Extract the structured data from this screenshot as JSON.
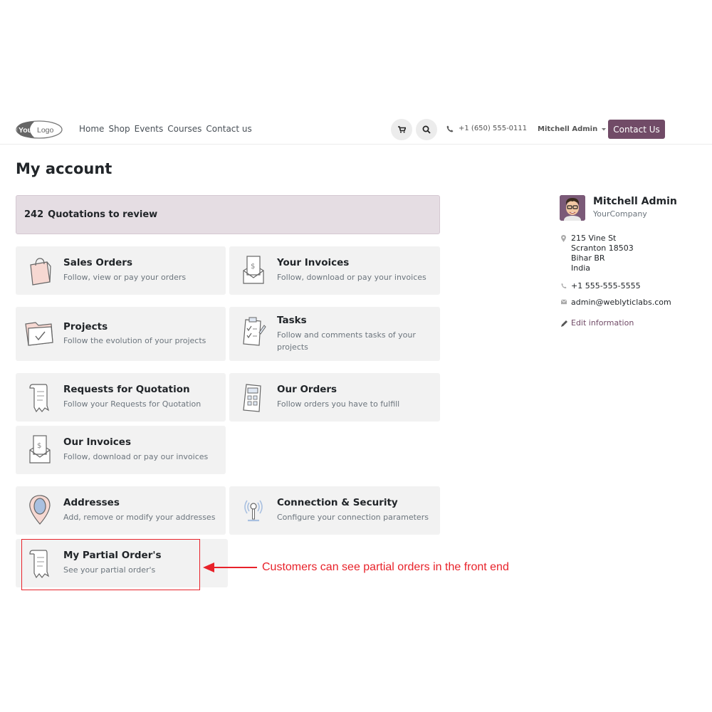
{
  "header": {
    "logo_text": "YourLogo",
    "nav": [
      "Home",
      "Shop",
      "Events",
      "Courses",
      "Contact us"
    ],
    "phone": "+1 (650) 555-0111",
    "user": "Mitchell Admin",
    "contact_button": "Contact Us",
    "brand_color": "#714b67"
  },
  "page": {
    "title": "My account"
  },
  "alert": {
    "count": "242",
    "label": "Quotations to review"
  },
  "cards": [
    {
      "title": "Sales Orders",
      "desc": "Follow, view or pay your orders",
      "icon": "shopping-bag-icon"
    },
    {
      "title": "Your Invoices",
      "desc": "Follow, download or pay your invoices",
      "icon": "invoice-envelope-icon"
    },
    {
      "title": "Projects",
      "desc": "Follow the evolution of your projects",
      "icon": "folder-check-icon"
    },
    {
      "title": "Tasks",
      "desc": "Follow and comments tasks of your projects",
      "icon": "checklist-icon"
    },
    {
      "title": "Requests for Quotation",
      "desc": "Follow your Requests for Quotation",
      "icon": "receipt-scroll-icon"
    },
    {
      "title": "Our Orders",
      "desc": "Follow orders you have to fulfill",
      "icon": "calculator-icon"
    },
    {
      "title": "Our Invoices",
      "desc": "Follow, download or pay our invoices",
      "icon": "invoice-envelope-icon"
    },
    {
      "title": "Addresses",
      "desc": "Add, remove or modify your addresses",
      "icon": "map-pin-icon"
    },
    {
      "title": "Connection & Security",
      "desc": "Configure your connection parameters",
      "icon": "signal-antenna-icon"
    },
    {
      "title": "My Partial Order's",
      "desc": "See your partial order's",
      "icon": "receipt-scroll-icon"
    }
  ],
  "sidebar": {
    "name": "Mitchell Admin",
    "company": "YourCompany",
    "address": [
      "215 Vine St",
      "Scranton 18503",
      "Bihar BR",
      "India"
    ],
    "phone": "+1 555-555-5555",
    "email": "admin@weblyticlabs.com",
    "edit_label": "Edit information"
  },
  "annotation": {
    "text": "Customers can see partial orders in the front end",
    "color": "#e8222a"
  }
}
